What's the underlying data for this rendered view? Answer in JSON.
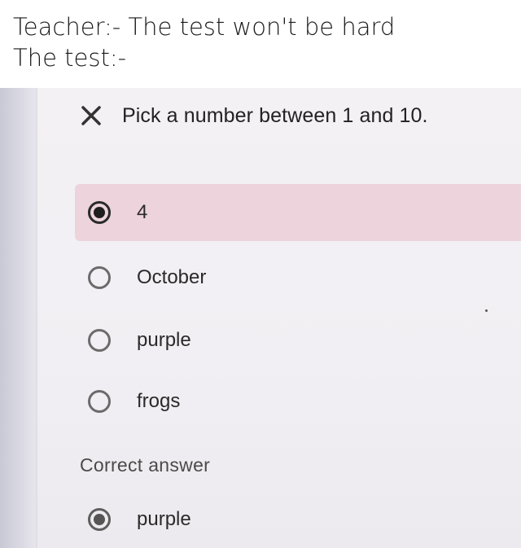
{
  "caption": {
    "line1": "Teacher:- The test won't be hard",
    "line2": "The test:-"
  },
  "quiz": {
    "question": "Pick a number between 1 and 10.",
    "result_icon": "close-icon",
    "options": [
      {
        "label": "4",
        "selected": true
      },
      {
        "label": "October",
        "selected": false
      },
      {
        "label": "purple",
        "selected": false
      },
      {
        "label": "frogs",
        "selected": false
      }
    ],
    "correct_heading": "Correct answer",
    "correct_option": {
      "label": "purple",
      "selected": true
    }
  },
  "colors": {
    "selected_highlight": "#ecd3dc",
    "text": "#222222"
  }
}
